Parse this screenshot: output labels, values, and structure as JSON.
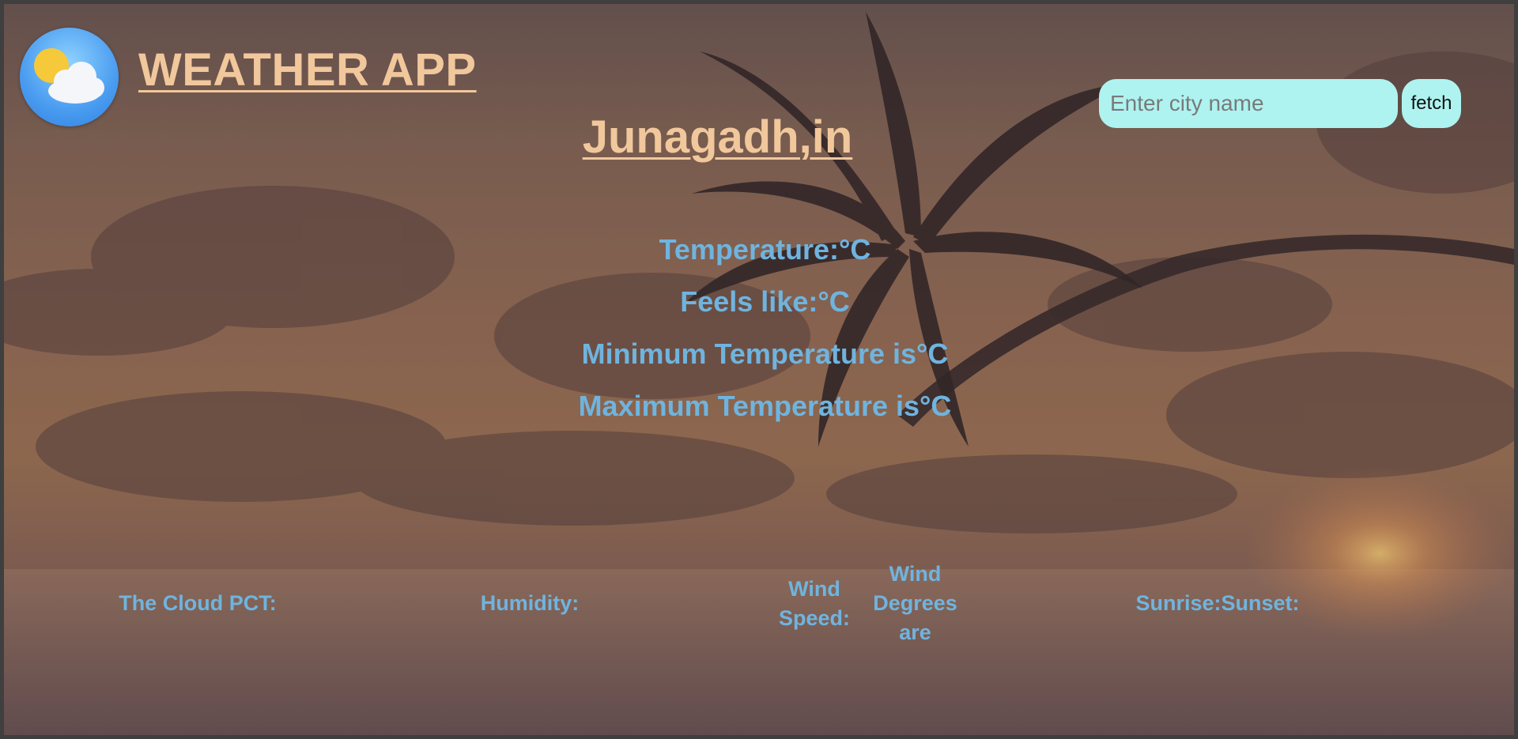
{
  "header": {
    "app_title": "WEATHER APP",
    "city_title": "Junagadh,in"
  },
  "search": {
    "placeholder": "Enter city name",
    "value": "",
    "button_label": "fetch"
  },
  "main": {
    "temperature": "Temperature:°C",
    "feels_like": "Feels like:°C",
    "min_temperature": "Minimum Temperature is°C",
    "max_temperature": "Maximum Temperature is°C"
  },
  "stats": {
    "cloud_pct": "The Cloud PCT:",
    "humidity": "Humidity:",
    "wind_speed": "Wind Speed:",
    "wind_degrees": "Wind Degrees are",
    "sun_times": "Sunrise:Sunset:"
  },
  "icons": {
    "logo": "weather-sun-cloud-icon"
  },
  "colors": {
    "title": "#f1c79c",
    "text": "#6fb4df",
    "input_bg": "#aef3f0",
    "frame": "#3f3f3f"
  }
}
